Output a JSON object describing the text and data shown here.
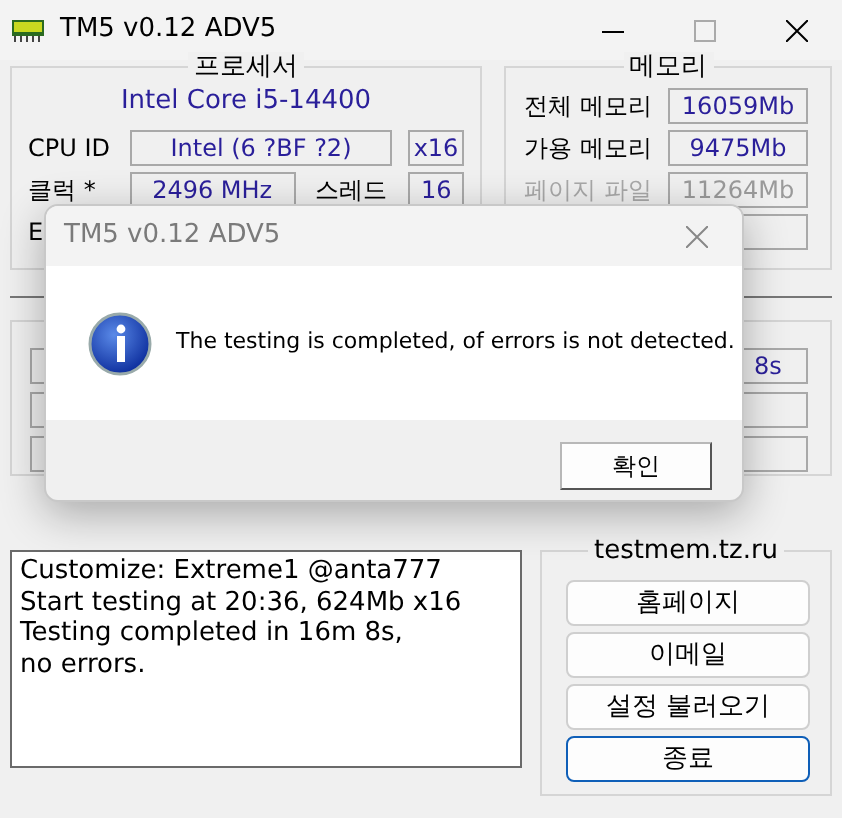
{
  "window": {
    "title": "TM5 v0.12 ADV5"
  },
  "processor": {
    "title": "프로세서",
    "model": "Intel Core i5-14400",
    "cpu_id_label": "CPU ID",
    "cpu_id": "Intel  (6 ?BF ?2)",
    "cores": "x16",
    "clock_label": "클럭 *",
    "clock": "2496 MHz",
    "threads_label": "스레드",
    "threads": "16",
    "row_3_label": "E"
  },
  "memory": {
    "title": "메모리",
    "rows": [
      {
        "label": "전체 메모리",
        "value": "16059Mb",
        "disabled": false
      },
      {
        "label": "가용 메모리",
        "value": "9475Mb",
        "disabled": false
      },
      {
        "label": "페이지 파일",
        "value": "11264Mb",
        "disabled": true
      }
    ]
  },
  "test": {
    "time_value": "8s"
  },
  "log": [
    "Customize: Extreme1 @anta777",
    "Start testing at 20:36, 624Mb x16",
    "Testing completed in 16m 8s,",
    "no errors."
  ],
  "links": {
    "title": "testmem.tz.ru",
    "buttons": [
      {
        "label": "홈페이지",
        "focused": false
      },
      {
        "label": "이메일",
        "focused": false
      },
      {
        "label": "설정 불러오기",
        "focused": false
      },
      {
        "label": "종료",
        "focused": true
      }
    ]
  },
  "dialog": {
    "title": "TM5 v0.12 ADV5",
    "message": "The testing is completed, of errors is not detected.",
    "button": "확인"
  }
}
